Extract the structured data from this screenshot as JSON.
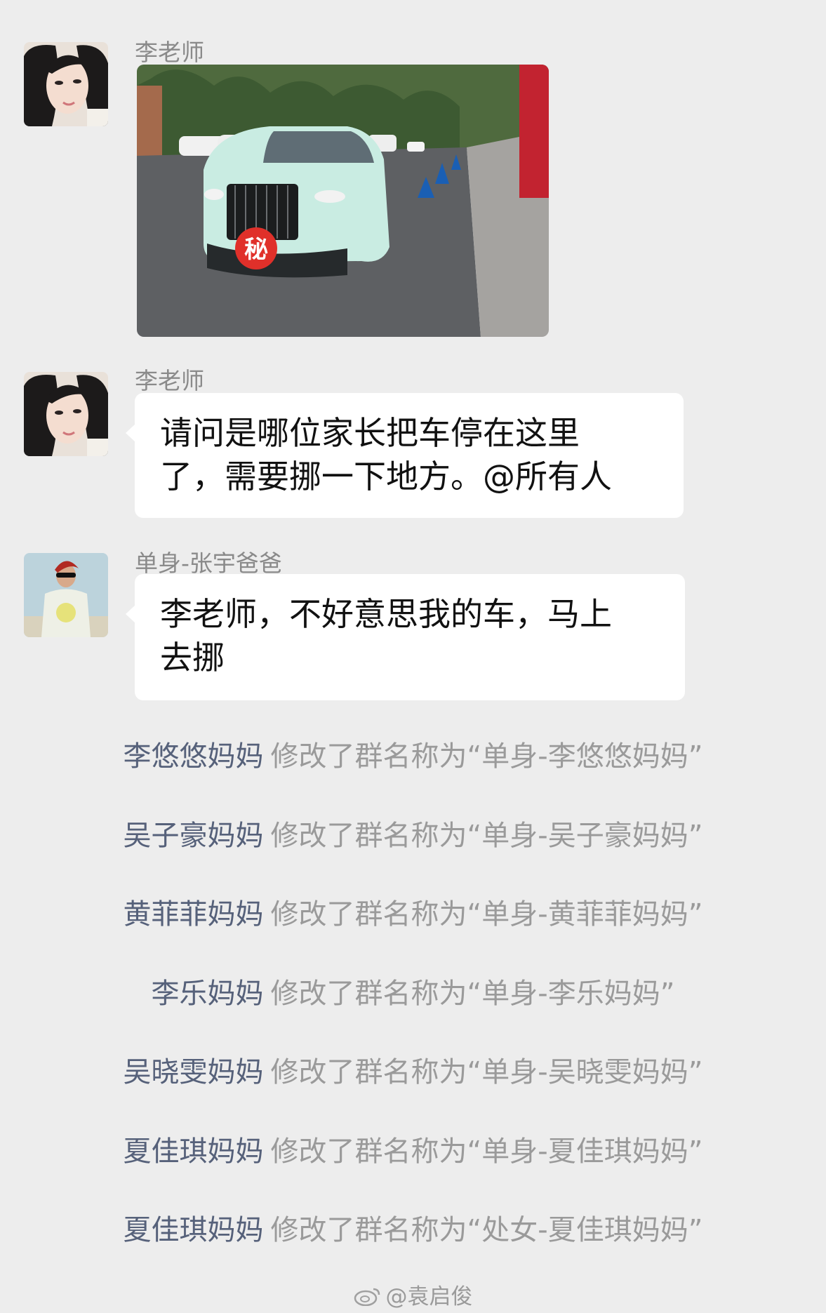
{
  "messages": [
    {
      "sender": "李老师",
      "type": "image",
      "image_badge": "秘"
    },
    {
      "sender": "李老师",
      "type": "text",
      "line1": "请问是哪位家长把车停在这里",
      "line2": "了，需要挪一下地方。@所有人"
    },
    {
      "sender": "单身-张宇爸爸",
      "type": "text",
      "line1": "李老师，不好意思我的车，马上",
      "line2": "去挪"
    }
  ],
  "system_messages": [
    {
      "who": "李悠悠妈妈",
      "action": "修改了群名称为“单身-李悠悠妈妈”"
    },
    {
      "who": "吴子豪妈妈",
      "action": "修改了群名称为“单身-吴子豪妈妈”"
    },
    {
      "who": "黄菲菲妈妈",
      "action": "修改了群名称为“单身-黄菲菲妈妈”"
    },
    {
      "who": "李乐妈妈",
      "action": "修改了群名称为“单身-李乐妈妈”"
    },
    {
      "who": "吴晓雯妈妈",
      "action": "修改了群名称为“单身-吴晓雯妈妈”"
    },
    {
      "who": "夏佳琪妈妈",
      "action": "修改了群名称为“单身-夏佳琪妈妈”"
    },
    {
      "who": "夏佳琪妈妈",
      "action": "修改了群名称为“处女-夏佳琪妈妈”"
    }
  ],
  "watermark": "@袁启俊",
  "icons": {
    "avatar_teacher": "woman-avatar-icon",
    "avatar_father": "man-avatar-icon",
    "weibo": "weibo-icon"
  },
  "colors": {
    "background": "#ededed",
    "bubble": "#ffffff",
    "system_name": "#56617a",
    "system_text": "#9a9a9a",
    "car": "#c9ece2",
    "badge": "#e0302a"
  }
}
